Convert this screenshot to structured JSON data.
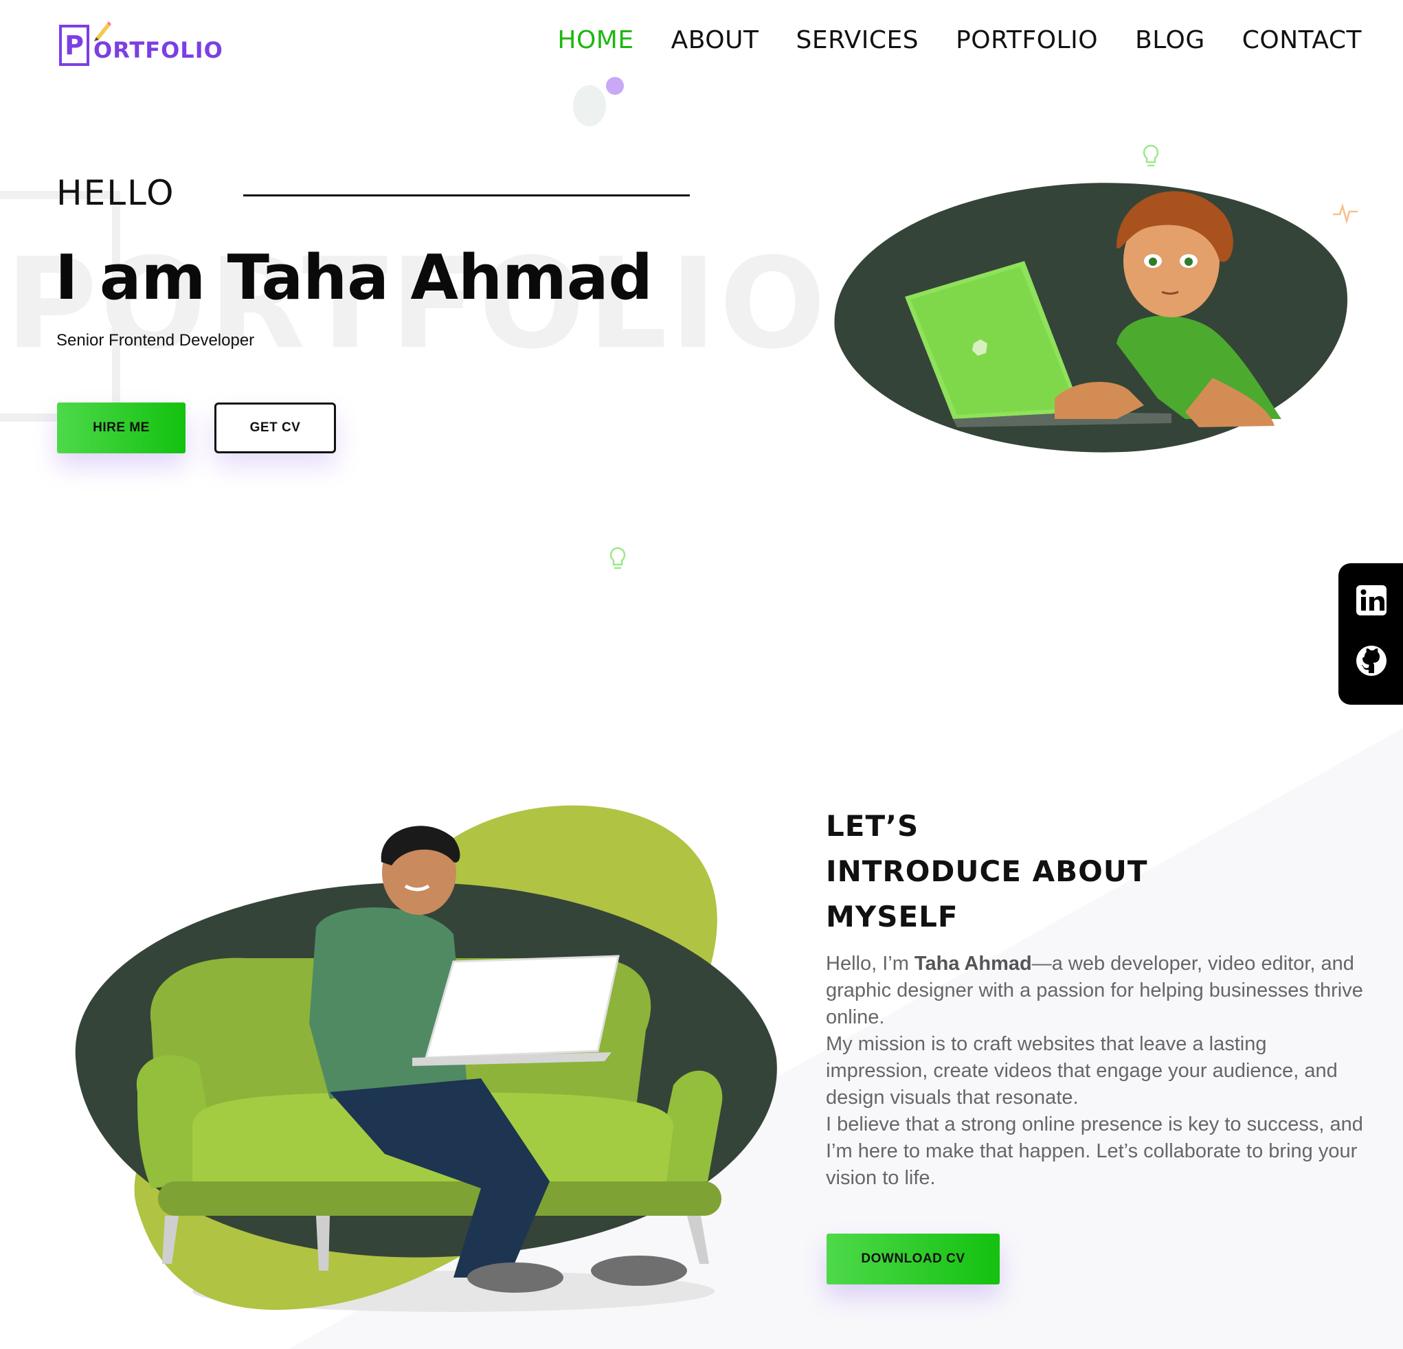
{
  "logo": {
    "letter": "P",
    "rest": "ORTFOLIO"
  },
  "nav": [
    {
      "label": "HOME",
      "active": true
    },
    {
      "label": "ABOUT",
      "active": false
    },
    {
      "label": "SERVICES",
      "active": false
    },
    {
      "label": "PORTFOLIO",
      "active": false
    },
    {
      "label": "BLOG",
      "active": false
    },
    {
      "label": "CONTACT",
      "active": false
    }
  ],
  "hero": {
    "watermark": "PORTFOLIO",
    "greeting": "HELLO",
    "name": "I am Taha Ahmad",
    "role": "Senior Frontend Developer",
    "hire_label": "HIRE ME",
    "cv_label": "GET CV"
  },
  "social": [
    {
      "icon": "linkedin-icon"
    },
    {
      "icon": "github-icon"
    }
  ],
  "about": {
    "title_lines": [
      "LET’S",
      "INTRODUCE ABOUT",
      "MYSELF"
    ],
    "intro_prefix": "Hello, I’m ",
    "intro_name": "Taha Ahmad",
    "intro_suffix": "—a web developer, video editor, and graphic designer with a passion for helping businesses thrive online.",
    "p2": "My mission is to craft websites that leave a lasting impression, create videos that engage your audience, and design visuals that resonate.",
    "p3": "I believe that a strong online presence is key to success, and I’m here to make that happen. Let’s collaborate to bring your vision to life.",
    "download_label": "DOWNLOAD CV"
  },
  "colors": {
    "accent_green": "#1db80e",
    "brand_purple": "#7b3fe4",
    "blob_dark": "#354438",
    "blob_lime": "#b1c343"
  }
}
